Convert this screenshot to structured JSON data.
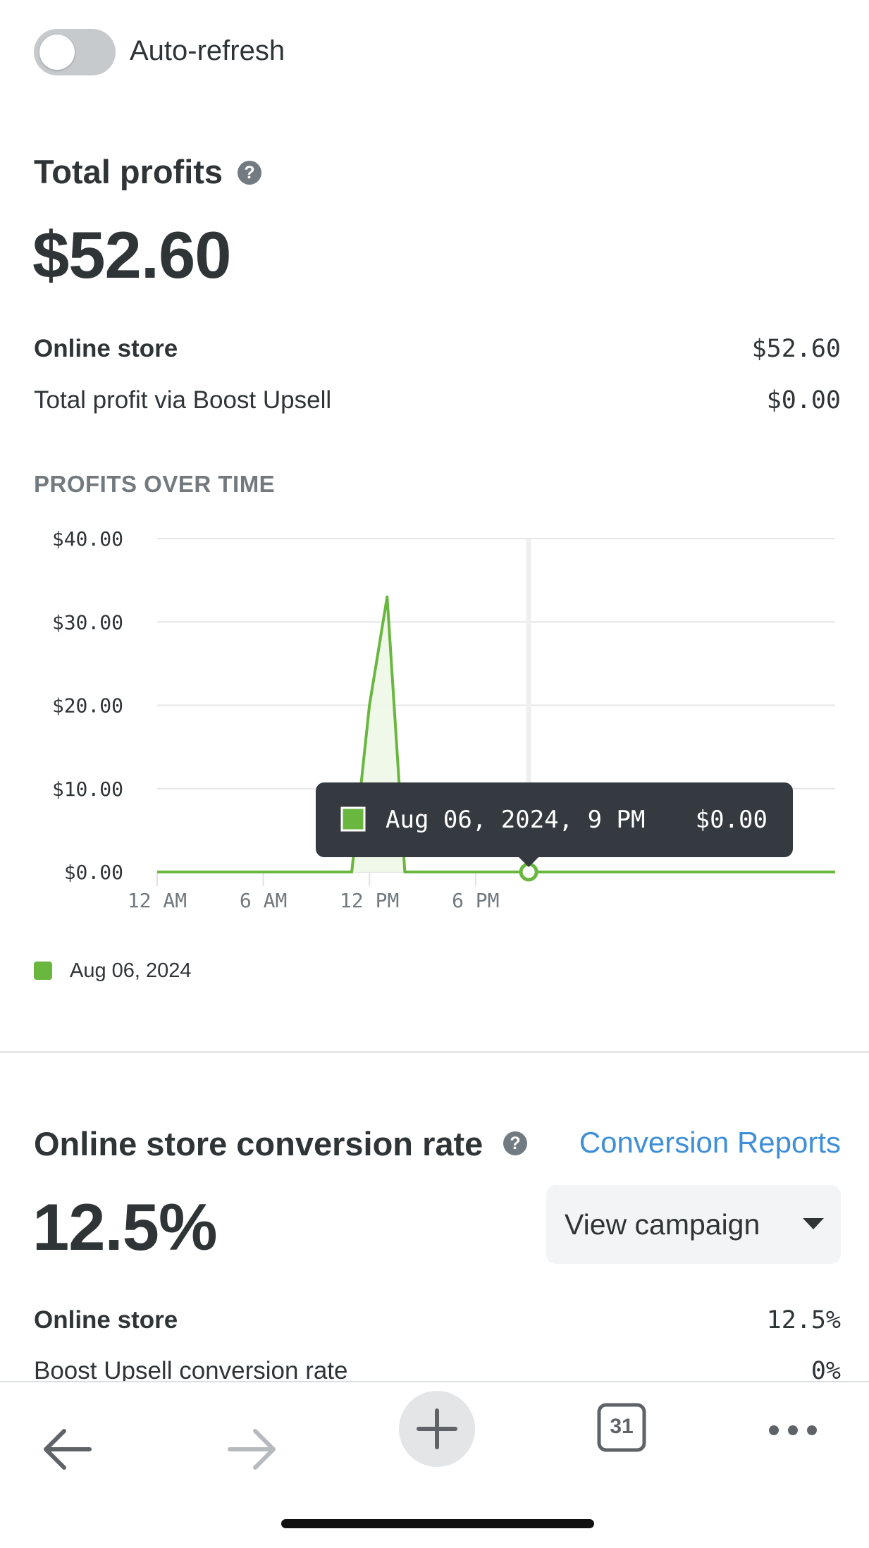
{
  "auto_refresh": {
    "label": "Auto-refresh",
    "enabled": false
  },
  "profits": {
    "title": "Total profits",
    "help_icon": "question-mark-icon",
    "total": "$52.60",
    "rows": [
      {
        "label": "Online store",
        "value": "$52.60"
      },
      {
        "label": "Total profit via Boost Upsell",
        "value": "$0.00"
      }
    ],
    "chart_heading": "PROFITS OVER TIME"
  },
  "chart_data": {
    "type": "area",
    "title": "PROFITS OVER TIME",
    "x": [
      "12 AM",
      "1 AM",
      "2 AM",
      "3 AM",
      "4 AM",
      "5 AM",
      "6 AM",
      "7 AM",
      "8 AM",
      "9 AM",
      "10 AM",
      "11 AM",
      "12 PM",
      "1 PM",
      "2 PM",
      "3 PM",
      "4 PM",
      "5 PM",
      "6 PM",
      "7 PM",
      "8 PM",
      "9 PM",
      "10 PM",
      "11 PM"
    ],
    "x_tick_labels": [
      "12 AM",
      "6 AM",
      "12 PM",
      "6 PM"
    ],
    "y_tick_labels": [
      "$0.00",
      "$10.00",
      "$20.00",
      "$30.00",
      "$40.00"
    ],
    "ylim": [
      0,
      40
    ],
    "grid": true,
    "series": [
      {
        "name": "Aug 06, 2024",
        "color": "#6ab740",
        "values": [
          0,
          0,
          0,
          0,
          0,
          0,
          0,
          0,
          0,
          0,
          0,
          0,
          20,
          33,
          0,
          0,
          0,
          0,
          0,
          0,
          0,
          0,
          0,
          0
        ]
      }
    ],
    "tooltip": {
      "label": "Aug 06, 2024, 9 PM",
      "value": "$0.00",
      "x": "9 PM",
      "y": 0
    },
    "legend": {
      "position": "bottom-left"
    }
  },
  "conversion": {
    "title": "Online store conversion rate",
    "help_icon": "question-mark-icon",
    "link_label": "Conversion Reports",
    "rate": "12.5%",
    "select_label": "View campaign",
    "rows": [
      {
        "label": "Online store",
        "value": "12.5%"
      },
      {
        "label": "Boost Upsell conversion rate",
        "value": "0%"
      }
    ]
  },
  "toolbar": {
    "back_icon": "arrow-left-icon",
    "forward_icon": "arrow-right-icon",
    "new_tab_icon": "plus-icon",
    "tabs_count": "31",
    "more_icon": "more-dots-icon"
  },
  "colors": {
    "accent_green": "#6ab740",
    "link_blue": "#3e8fd8",
    "text": "#2f3437",
    "muted": "#72797f"
  }
}
